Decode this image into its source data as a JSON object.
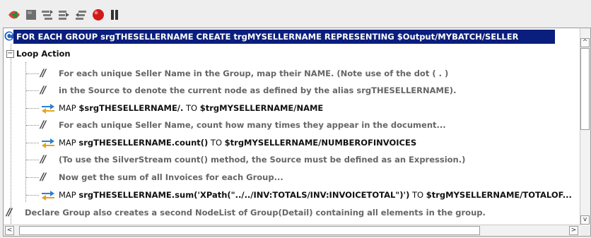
{
  "toolbar": {
    "buttons": [
      {
        "name": "run-icon",
        "color": "#d9453a"
      },
      {
        "name": "stop-icon",
        "color": "#6e6e6e"
      },
      {
        "name": "step-over-icon",
        "color": "#7b7b7b"
      },
      {
        "name": "step-into-icon",
        "color": "#7b7b7b"
      },
      {
        "name": "step-out-icon",
        "color": "#7b7b7b"
      },
      {
        "name": "breakpoint-icon",
        "color": "#d11a1a"
      },
      {
        "name": "pause-icon",
        "color": "#333333"
      }
    ]
  },
  "editor": {
    "selected_line": "FOR EACH GROUP srgTHESELLERNAME CREATE trgMYSELLERNAME REPRESENTING $Output/MYBATCH/SELLER",
    "loop_node": {
      "expander": "−",
      "label": "Loop Action"
    },
    "lines": [
      {
        "kind": "comment",
        "text": "For each unique Seller Name in the Group, map their NAME.  (Note use of the dot ( . )"
      },
      {
        "kind": "comment",
        "text": "in the Source to denote the current node as defined by the alias srgTHESELLERNAME)."
      },
      {
        "kind": "map",
        "keyword": "MAP",
        "source": "$srgTHESELLERNAME/.",
        "to": "TO",
        "target": "$trgMYSELLERNAME/NAME"
      },
      {
        "kind": "comment",
        "text": "For each unique Seller Name, count how many times they appear in the document..."
      },
      {
        "kind": "map",
        "keyword": "MAP",
        "source": "srgTHESELLERNAME.count()",
        "to": "TO",
        "target": "$trgMYSELLERNAME/NUMBEROFINVOICES"
      },
      {
        "kind": "comment",
        "text": "(To use the SilverStream count() method, the Source must be defined as an Expression.)"
      },
      {
        "kind": "comment",
        "text": "Now get the sum of all Invoices for each Group..."
      },
      {
        "kind": "map",
        "keyword": "MAP",
        "source": "srgTHESELLERNAME.sum('XPath(\"../../INV:TOTALS/INV:INVOICETOTAL\")')",
        "to": "TO",
        "target": "$trgMYSELLERNAME/TOTALOF..."
      }
    ],
    "bottom_comment": "Declare Group also creates a second NodeList of Group(Detail) containing all elements in the group."
  },
  "scrollbars": {
    "up": "^",
    "down": "v",
    "left": "<",
    "right": ">"
  }
}
